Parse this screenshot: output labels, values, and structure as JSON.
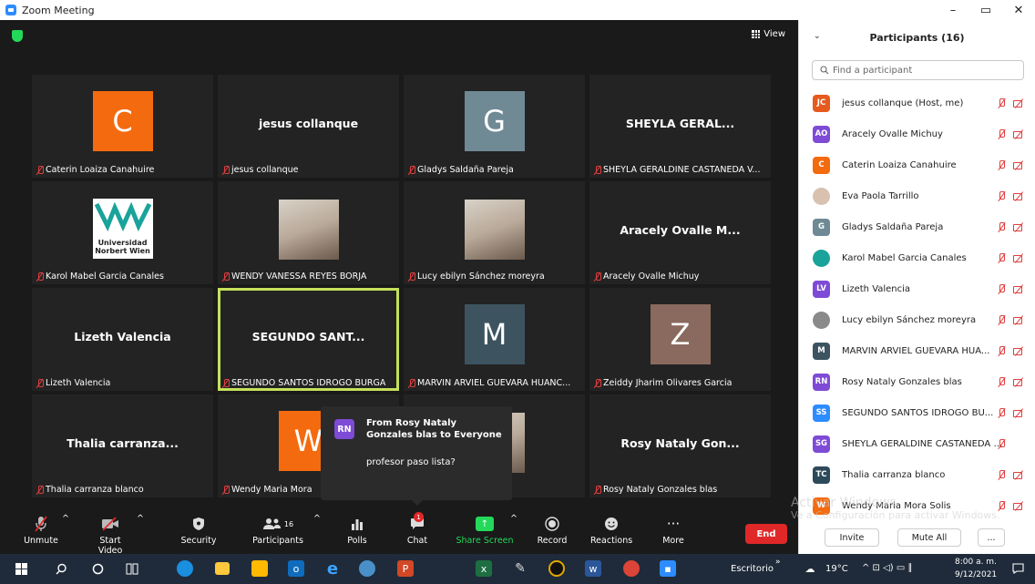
{
  "window": {
    "title": "Zoom Meeting",
    "minimize": "–",
    "maximize": "▭",
    "close": "✕"
  },
  "meeting": {
    "view_label": "View",
    "tiles": [
      {
        "type": "initial",
        "initial": "C",
        "color": "#f46a0f",
        "label": "Caterin Loaiza Canahuire"
      },
      {
        "type": "name",
        "big": "jesus collanque",
        "label": "jesus collanque"
      },
      {
        "type": "initial",
        "initial": "G",
        "color": "#6f8a95",
        "label": "Gladys Saldaña Pareja"
      },
      {
        "type": "name",
        "big": "SHEYLA GERAL...",
        "label": "SHEYLA GERALDINE CASTAÑEDA V..."
      },
      {
        "type": "logo",
        "logo_line1": "Universidad",
        "logo_line2": "Norbert Wien",
        "label": "Karol Mabel Garcia Canales"
      },
      {
        "type": "photo",
        "label": "WENDY VANESSA REYES BORJA"
      },
      {
        "type": "photo",
        "label": "Lucy ebilyn Sánchez moreyra"
      },
      {
        "type": "name",
        "big": "Aracely Ovalle M...",
        "label": "Aracely Ovalle Michuy"
      },
      {
        "type": "name",
        "big": "Lizeth Valencia",
        "label": "Lizeth Valencia"
      },
      {
        "type": "name",
        "big": "SEGUNDO SANT...",
        "label": "SEGUNDO SANTOS IDROGO BURGA",
        "active": true
      },
      {
        "type": "initial",
        "initial": "M",
        "color": "#3d5460",
        "label": "MARVIN ARVIEL GUEVARA HUANC..."
      },
      {
        "type": "initial",
        "initial": "Z",
        "color": "#8a6a5e",
        "label": "Zeiddy Jharim Olivares Garcia"
      },
      {
        "type": "name",
        "big": "Thalia carranza...",
        "label": "Thalia carranza blanco"
      },
      {
        "type": "initial",
        "initial": "W",
        "color": "#f46a0f",
        "label": "Wendy Maria Mora"
      },
      {
        "type": "photo",
        "label": ""
      },
      {
        "type": "name",
        "big": "Rosy Nataly Gon...",
        "label": "Rosy Nataly Gonzales blas"
      }
    ]
  },
  "chat_popup": {
    "initials": "RN",
    "from": "From Rosy Nataly Gonzales blas to Everyone",
    "message": "profesor paso lista?"
  },
  "toolbar": {
    "unmute": "Unmute",
    "start_video": "Start Video",
    "security": "Security",
    "participants": "Participants",
    "participants_count": "16",
    "polls": "Polls",
    "chat": "Chat",
    "chat_badge": "1",
    "share_screen": "Share Screen",
    "record": "Record",
    "reactions": "Reactions",
    "more": "More",
    "end": "End"
  },
  "panel": {
    "title": "Participants (16)",
    "search_placeholder": "Find a participant",
    "participants": [
      {
        "initials": "JC",
        "color": "#e65a1e",
        "name": "jesus collanque (Host, me)",
        "cam": true
      },
      {
        "initials": "AO",
        "color": "#7e4bd6",
        "name": "Aracely Ovalle Michuy",
        "cam": true
      },
      {
        "initials": "C",
        "color": "#f46a0f",
        "name": "Caterin Loaiza Canahuire",
        "cam": true
      },
      {
        "initials": "",
        "color": "#d9c1b0",
        "name": "Eva Paola Tarrillo",
        "cam": true
      },
      {
        "initials": "G",
        "color": "#6f8a95",
        "name": "Gladys Saldaña Pareja",
        "cam": true
      },
      {
        "initials": "",
        "color": "#1aa39a",
        "name": "Karol Mabel Garcia Canales",
        "cam": true
      },
      {
        "initials": "LV",
        "color": "#7e4bd6",
        "name": "Lizeth Valencia",
        "cam": true
      },
      {
        "initials": "",
        "color": "#8a8a8a",
        "name": "Lucy ebilyn Sánchez moreyra",
        "cam": true
      },
      {
        "initials": "M",
        "color": "#3d5460",
        "name": "MARVIN ARVIEL GUEVARA HUA...",
        "cam": true
      },
      {
        "initials": "RN",
        "color": "#7e4bd6",
        "name": "Rosy Nataly Gonzales blas",
        "cam": true
      },
      {
        "initials": "SS",
        "color": "#2d8cff",
        "name": "SEGUNDO SANTOS IDROGO BU...",
        "cam": true
      },
      {
        "initials": "SG",
        "color": "#7e4bd6",
        "name": "SHEYLA GERALDINE CASTAÑEDA V...",
        "cam": false
      },
      {
        "initials": "TC",
        "color": "#2c4a5a",
        "name": "Thalia carranza blanco",
        "cam": true
      },
      {
        "initials": "W",
        "color": "#f46a0f",
        "name": "Wendy Maria Mora Solis",
        "cam": true
      }
    ],
    "invite": "Invite",
    "mute_all": "Mute All",
    "more": "..."
  },
  "watermark": {
    "line1": "Activar Windows",
    "line2": "Ve a Configuración para activar Windows."
  },
  "taskbar": {
    "desktop_label": "Escritorio",
    "temp": "19°C",
    "time": "8:00 a. m.",
    "date": "9/12/2021"
  }
}
